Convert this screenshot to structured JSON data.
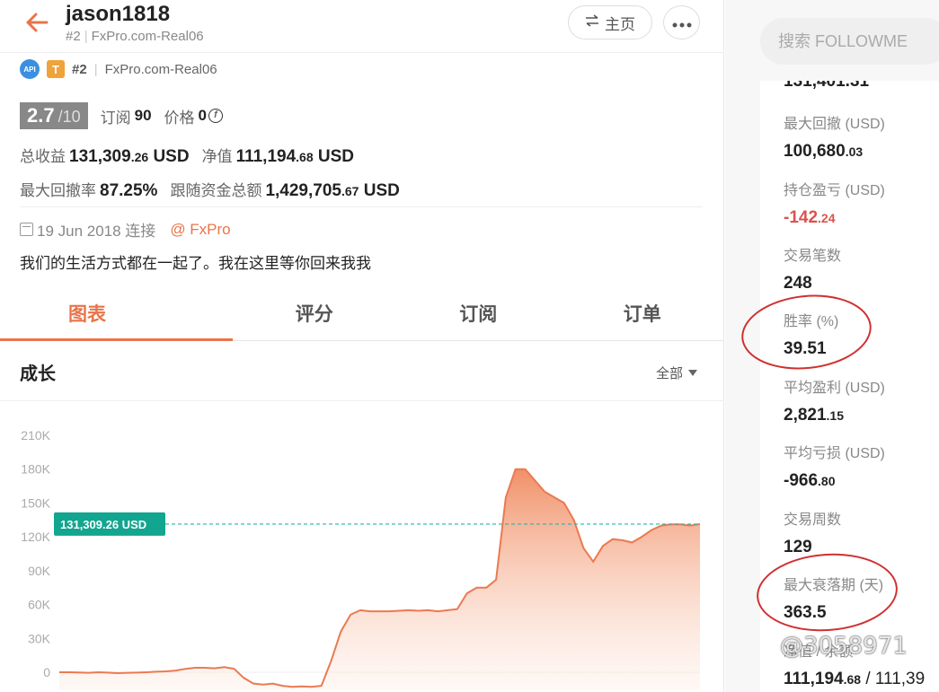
{
  "header": {
    "back_icon": "arrow-left-icon",
    "username": "jason1818",
    "rank": "#2",
    "broker": "FxPro.com-Real06",
    "home_label": "主页",
    "home_icon": "swap-arrows-icon",
    "more_icon": "ellipsis-icon"
  },
  "badges": {
    "api": "API",
    "t": "T",
    "rank": "#2",
    "broker": "FxPro.com-Real06"
  },
  "rating": {
    "score": "2.7",
    "score_max": "/10",
    "subs_label": "订阅",
    "subs_value": "90",
    "price_label": "价格",
    "price_value": "0"
  },
  "stats": {
    "total_profit_label": "总收益",
    "total_profit_main": "131,309",
    "total_profit_dec": ".26",
    "total_profit_unit": "USD",
    "equity_label": "净值",
    "equity_main": "111,194",
    "equity_dec": ".68",
    "equity_unit": "USD",
    "max_dd_label": "最大回撤率",
    "max_dd_value": "87.25%",
    "follow_funds_label": "跟随资金总额",
    "follow_funds_main": "1,429,705",
    "follow_funds_dec": ".67",
    "follow_funds_unit": "USD"
  },
  "connection": {
    "date_text": "19 Jun 2018 连接",
    "at_broker": "@ FxPro"
  },
  "bio": "我们的生活方式都在一起了。我在这里等你回来我我",
  "tabs": [
    {
      "label": "图表",
      "active": true
    },
    {
      "label": "评分",
      "active": false
    },
    {
      "label": "订阅",
      "active": false
    },
    {
      "label": "订单",
      "active": false
    }
  ],
  "growth": {
    "title": "成长",
    "range_label": "全部"
  },
  "chart_data": {
    "type": "area",
    "y_ticks": [
      "210K",
      "180K",
      "150K",
      "120K",
      "90K",
      "60K",
      "30K",
      "0"
    ],
    "ylim": [
      0,
      210000
    ],
    "current_label": "131,309.26 USD",
    "current_value": 131309.26,
    "series": [
      {
        "values": [
          0,
          0,
          -200,
          -500,
          0,
          -300,
          -800,
          -500,
          -300,
          0,
          500,
          800,
          1500,
          3000,
          4000,
          4000,
          3500,
          4500,
          3000,
          -5000,
          -10000,
          -11000,
          -10000,
          -12000,
          -13000,
          -12500,
          -13000,
          -12000,
          10000,
          36000,
          51000,
          55000,
          54000,
          54000,
          54000,
          54500,
          55000,
          54500,
          55000,
          54000,
          55000,
          56000,
          70000,
          75000,
          75000,
          82000,
          155000,
          180000,
          180000,
          170000,
          160000,
          155000,
          150000,
          135000,
          110000,
          98000,
          112000,
          118000,
          117000,
          115000,
          120000,
          126000,
          130000,
          131000,
          131000,
          130000,
          131309.26
        ]
      }
    ]
  },
  "sidebar": {
    "search_placeholder": "搜索 FOLLOWME",
    "cut_top": "131,401.31",
    "items": [
      {
        "label": "最大回撤 (USD)",
        "main": "100,680",
        "dec": ".03",
        "negative": false
      },
      {
        "label": "持仓盈亏 (USD)",
        "main": "-142",
        "dec": ".24",
        "negative": true
      },
      {
        "label": "交易笔数",
        "main": "248",
        "dec": "",
        "negative": false
      },
      {
        "label": "胜率 (%)",
        "main": "39.51",
        "dec": "",
        "negative": false
      },
      {
        "label": "平均盈利 (USD)",
        "main": "2,821",
        "dec": ".15",
        "negative": false
      },
      {
        "label": "平均亏损 (USD)",
        "main": "-966",
        "dec": ".80",
        "negative": false
      },
      {
        "label": "交易周数",
        "main": "129",
        "dec": "",
        "negative": false
      },
      {
        "label": "最大衰落期 (天)",
        "main": "363.5",
        "dec": "",
        "negative": false
      }
    ],
    "bottom_label": "净值 / 余额",
    "bottom_main": "111,194",
    "bottom_dec": ".68",
    "bottom_rest": " / 111,39"
  },
  "watermark": "@3058971"
}
